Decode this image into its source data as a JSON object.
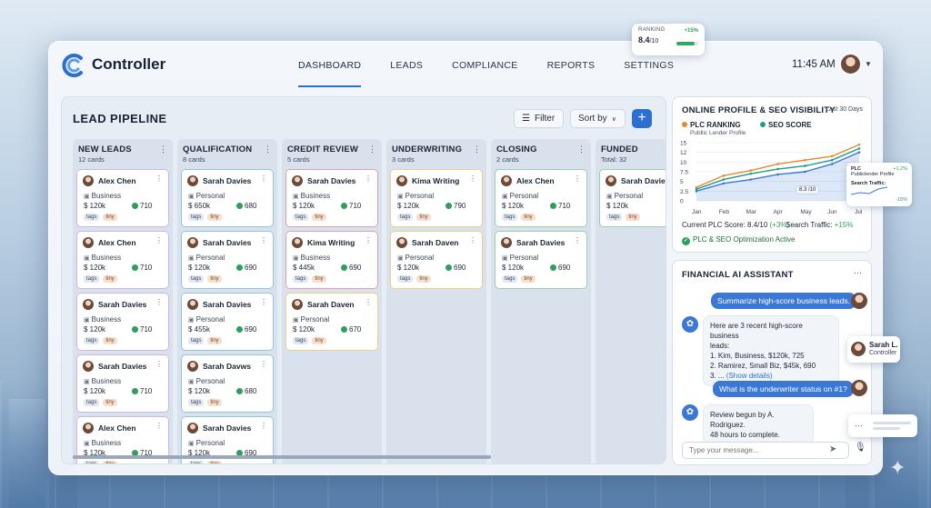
{
  "ranking_chip": {
    "label": "RANKING",
    "change": "+15%",
    "value": "8.4",
    "value_suffix": "/10",
    "progress": 0.84
  },
  "app": {
    "name": "Controller"
  },
  "nav": {
    "tabs": [
      "DASHBOARD",
      "LEADS",
      "COMPLIANCE",
      "REPORTS",
      "SETTINGS"
    ],
    "active": "DASHBOARD"
  },
  "clock": "11:45 AM",
  "pipeline": {
    "title": "LEAD PIPELINE",
    "filter_label": "Filter",
    "sort_label": "Sort by",
    "add_label": "+",
    "columns": [
      {
        "name": "NEW LEADS",
        "count": "12 cards",
        "cards": [
          {
            "name": "Alex Chen",
            "type": "Business",
            "amount": "$ 120k",
            "score": "710",
            "tags": [
              "tags",
              "tiny"
            ],
            "border": "purple"
          },
          {
            "name": "Alex Chen",
            "type": "Business",
            "amount": "$ 120k",
            "score": "710",
            "tags": [
              "tags",
              "tiny"
            ],
            "border": "purple"
          },
          {
            "name": "Sarah Davies",
            "type": "Business",
            "amount": "$ 120k",
            "score": "710",
            "tags": [
              "tags",
              "tiny"
            ],
            "border": "purple"
          },
          {
            "name": "Sarah Davies",
            "type": "Business",
            "amount": "$ 120k",
            "score": "710",
            "tags": [
              "tags",
              "tiny"
            ],
            "border": "purple"
          },
          {
            "name": "Alex Chen",
            "type": "Business",
            "amount": "$ 120k",
            "score": "710",
            "tags": [
              "tags",
              "tiny"
            ],
            "border": "purple"
          }
        ]
      },
      {
        "name": "QUALIFICATION",
        "count": "8 cards",
        "cards": [
          {
            "name": "Sarah Davies",
            "type": "Personal",
            "amount": "$ 650k",
            "score": "680",
            "tags": [
              "tags",
              "tiny"
            ],
            "border": "blue"
          },
          {
            "name": "Sarah Davies",
            "type": "Personal",
            "amount": "$ 120k",
            "score": "690",
            "tags": [
              "tags",
              "tiny"
            ],
            "border": "blue"
          },
          {
            "name": "Sarah Davies",
            "type": "Personal",
            "amount": "$ 455k",
            "score": "690",
            "tags": [
              "tags",
              "tiny"
            ],
            "border": "blue"
          },
          {
            "name": "Sarah Davws",
            "type": "Personal",
            "amount": "$ 120k",
            "score": "680",
            "tags": [
              "tags",
              "tiny"
            ],
            "border": "blue"
          },
          {
            "name": "Sarah Davies",
            "type": "Personal",
            "amount": "$ 120k",
            "score": "690",
            "tags": [
              "tags",
              "tiny"
            ],
            "border": "blue"
          }
        ]
      },
      {
        "name": "CREDIT REVIEW",
        "count": "5 cards",
        "cards": [
          {
            "name": "Sarah Davies",
            "type": "Business",
            "amount": "$ 120k",
            "score": "710",
            "tags": [
              "tags",
              "tiny"
            ],
            "border": "red"
          },
          {
            "name": "Kima Writing",
            "type": "Business",
            "amount": "$ 445k",
            "score": "690",
            "tags": [
              "tags",
              "tiny"
            ],
            "border": "red"
          },
          {
            "name": "Sarah Daven",
            "type": "Personal",
            "amount": "$ 120k",
            "score": "670",
            "tags": [
              "tags",
              "tiny"
            ],
            "border": "orange"
          }
        ]
      },
      {
        "name": "UNDERWRITING",
        "count": "3 cards",
        "cards": [
          {
            "name": "Kima Writing",
            "type": "Personal",
            "amount": "$ 120k",
            "score": "790",
            "tags": [
              "tags",
              "tiny"
            ],
            "border": "orange"
          },
          {
            "name": "Sarah Daven",
            "type": "Personal",
            "amount": "$ 120k",
            "score": "690",
            "tags": [
              "tags",
              "tiny"
            ],
            "border": "orange"
          }
        ]
      },
      {
        "name": "CLOSING",
        "count": "2 cards",
        "cards": [
          {
            "name": "Alex Chen",
            "type": "Personal",
            "amount": "$ 120k",
            "score": "710",
            "tags": [
              "tags",
              "tiny"
            ],
            "border": "green"
          },
          {
            "name": "Sarah Davies",
            "type": "Personal",
            "amount": "$ 120k",
            "score": "690",
            "tags": [
              "tags",
              "tiny"
            ],
            "border": "green"
          }
        ]
      },
      {
        "name": "FUNDED",
        "count": "Total: 32",
        "cards": [
          {
            "name": "Sarah Davie",
            "type": "Personal",
            "amount": "$ 120k",
            "score": "",
            "tags": [
              "tags",
              "tiny"
            ],
            "border": "green"
          }
        ]
      }
    ]
  },
  "seo": {
    "title": "ONLINE PROFILE & SEO VISIBILITY",
    "period": "Last 30 Days",
    "legend_plc": "PLC RANKING",
    "legend_plc_sub": "Publlic Lender Profile",
    "legend_seo": "SEO SCORE",
    "tooltip": "8.3 /10",
    "current_plc": "Current PLC Score: 8.4/10 ",
    "current_plc_change": "(+3%)",
    "traffic": "Search Traffic: ",
    "traffic_change": "+15%",
    "status": "PLC & SEO Optimization Active",
    "chart_data": {
      "type": "line",
      "x": [
        "Jan",
        "Feb",
        "Mar",
        "Apr",
        "May",
        "Jun",
        "Jul"
      ],
      "ylim": [
        0,
        15
      ],
      "yticks": [
        "15",
        "12",
        "10",
        "7.5",
        "5",
        "2.5",
        "0"
      ],
      "series": [
        {
          "name": "PLC RANKING",
          "values": [
            3.5,
            6.5,
            7.8,
            9.5,
            10.5,
            11.5,
            14.5
          ],
          "color": "#e38b2c"
        },
        {
          "name": "SEO SCORE",
          "values": [
            3.0,
            5.5,
            7.0,
            8.2,
            9.0,
            10.5,
            13.5
          ],
          "color": "#1e9b8f"
        },
        {
          "values": [
            2.5,
            4.5,
            5.5,
            6.8,
            7.5,
            9.5,
            12.5
          ],
          "color": "#3b78d6"
        }
      ]
    }
  },
  "plc_float": {
    "line1": "PLC",
    "line1b": "Publiclender Profile",
    "change1": "+1.2%",
    "line2": "Search Traffic:",
    "change2": "-15%"
  },
  "assistant": {
    "title": "FINANCIAL AI ASSISTANT",
    "msg1": "Summarize high-score business leads.",
    "reply1": [
      "Here are 3 recent high-score business",
      "leads:",
      "1. Kim, Business, $120k, 725",
      "2. Ramirez, Small Biz, $45k, 690",
      "3. ... "
    ],
    "reply1_link": "(Show details)",
    "msg2": "What is the underwriter status on #1?",
    "reply2": [
      "Review begun by A. Rodriguez.",
      "48 hours to complete."
    ],
    "placeholder": "Type your message..."
  },
  "user_float": {
    "name": "Sarah L.",
    "role": "Controller"
  }
}
